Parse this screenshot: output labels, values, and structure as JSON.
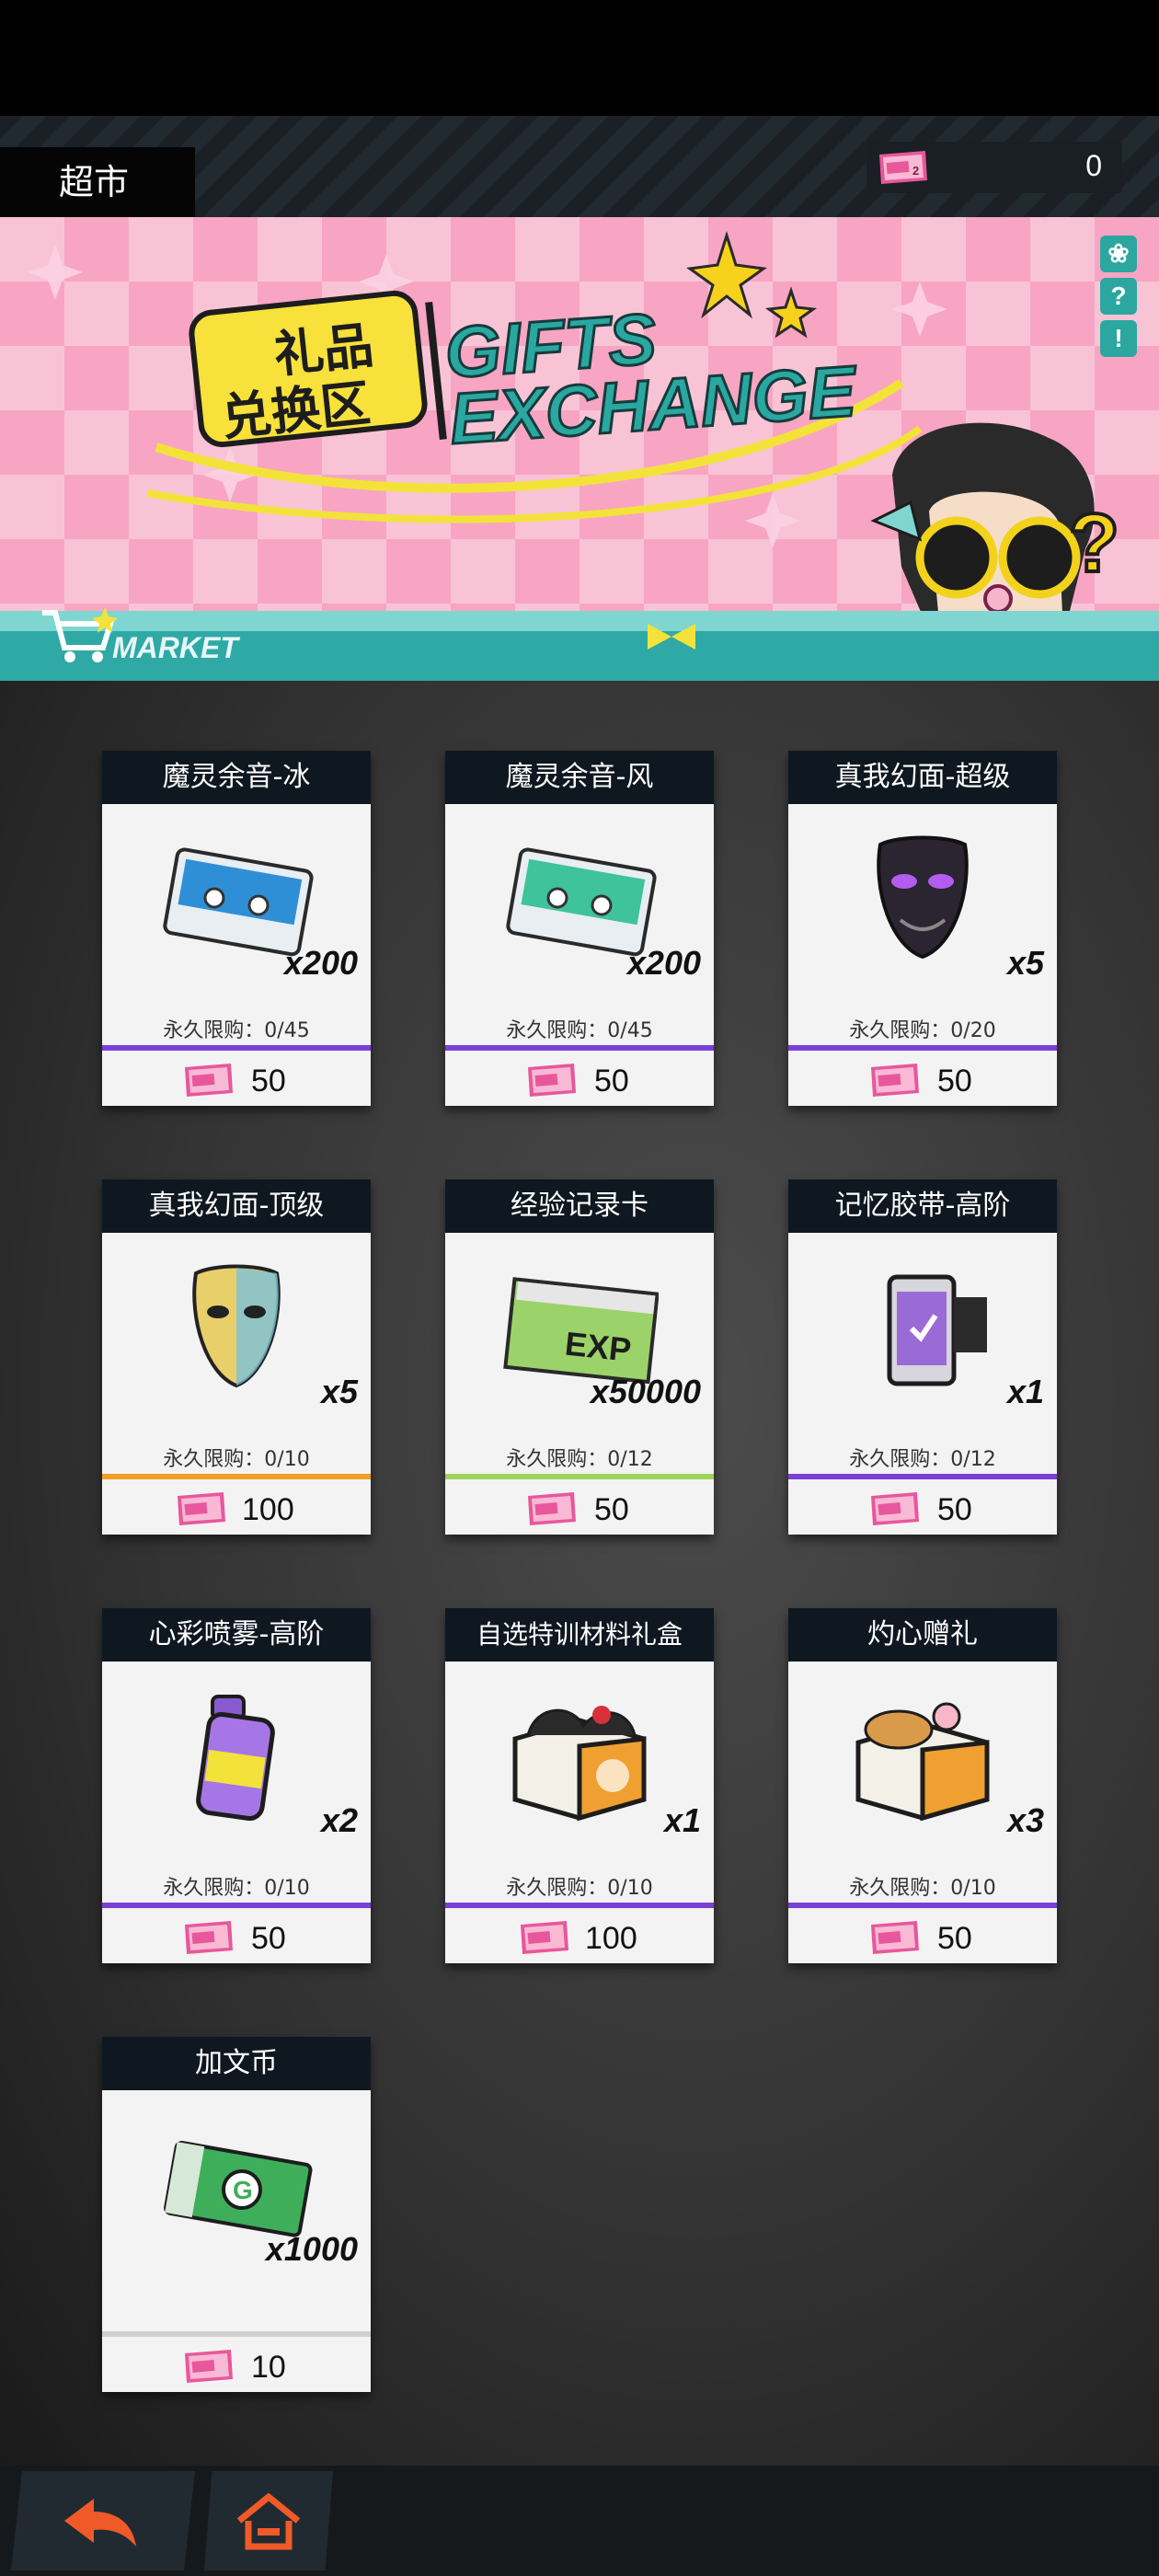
{
  "header": {
    "title": "超市",
    "currency_count": "0"
  },
  "banner": {
    "title_cn_line1": "礼品",
    "title_cn_line2": "兑换区",
    "title_en_line1": "GIFTS",
    "title_en_line2": "EXCHANGE",
    "market_label": "MARKET",
    "side_icons": [
      "rabbit-icon",
      "help-icon",
      "info-icon"
    ]
  },
  "items": [
    {
      "name": "魔灵余音-冰",
      "qty": "x200",
      "limit": "永久限购：0/45",
      "price": "50",
      "line_color": "#7a3fd6",
      "icon": "cassette-ice-icon"
    },
    {
      "name": "魔灵余音-风",
      "qty": "x200",
      "limit": "永久限购：0/45",
      "price": "50",
      "line_color": "#7a3fd6",
      "icon": "cassette-wind-icon"
    },
    {
      "name": "真我幻面-超级",
      "qty": "x5",
      "limit": "永久限购：0/20",
      "price": "50",
      "line_color": "#7a3fd6",
      "icon": "mask-purple-icon"
    },
    {
      "name": "真我幻面-顶级",
      "qty": "x5",
      "limit": "永久限购：0/10",
      "price": "100",
      "line_color": "#f0a020",
      "icon": "mask-gold-icon"
    },
    {
      "name": "经验记录卡",
      "qty": "x50000",
      "limit": "永久限购：0/12",
      "price": "50",
      "line_color": "#9ed35a",
      "icon": "exp-card-icon"
    },
    {
      "name": "记忆胶带-高阶",
      "qty": "x1",
      "limit": "永久限购：0/12",
      "price": "50",
      "line_color": "#7a3fd6",
      "icon": "memory-film-icon"
    },
    {
      "name": "心彩喷雾-高阶",
      "qty": "x2",
      "limit": "永久限购：0/10",
      "price": "50",
      "line_color": "#7a3fd6",
      "icon": "spray-can-icon"
    },
    {
      "name": "自选特训材料礼盒",
      "qty": "x1",
      "limit": "永久限购：0/10",
      "price": "100",
      "line_color": "#7a3fd6",
      "icon": "gift-box-icon"
    },
    {
      "name": "灼心赠礼",
      "qty": "x3",
      "limit": "永久限购：0/10",
      "price": "50",
      "line_color": "#7a3fd6",
      "icon": "food-box-icon"
    },
    {
      "name": "加文币",
      "qty": "x1000",
      "limit": "",
      "price": "10",
      "line_color": "#cfcfd4",
      "icon": "coin-ticket-icon"
    }
  ],
  "nav": {
    "back_icon": "back-arrow-icon",
    "home_icon": "home-icon"
  },
  "colors": {
    "accent_pink": "#e8579b",
    "teal": "#2fa9a6",
    "header_dark": "#0f1821"
  }
}
